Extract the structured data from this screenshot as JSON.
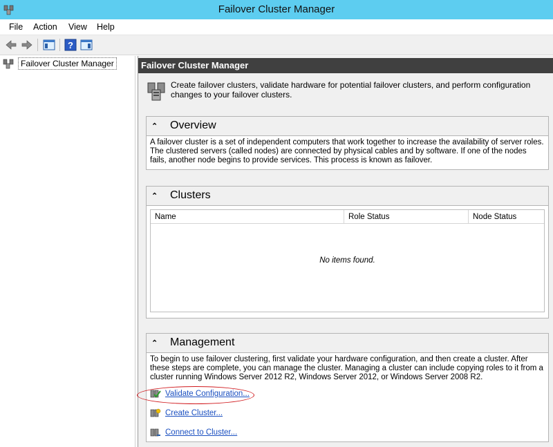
{
  "window": {
    "title": "Failover Cluster Manager",
    "app_icon": "cluster-icon"
  },
  "menu": {
    "file": "File",
    "action": "Action",
    "view": "View",
    "help": "Help"
  },
  "toolbar": {
    "icons": [
      "back-arrow-icon",
      "forward-arrow-icon",
      "show-hide-console-tree-icon",
      "help-icon",
      "show-hide-action-pane-icon"
    ]
  },
  "tree": {
    "root_label": "Failover Cluster Manager"
  },
  "main": {
    "header": "Failover Cluster Manager",
    "intro": "Create failover clusters, validate hardware for potential failover clusters, and perform configuration changes to your failover clusters."
  },
  "overview": {
    "title": "Overview",
    "text": "A failover cluster is a set of independent computers that work together to increase the availability of server roles. The clustered servers (called nodes) are connected by physical cables and by software. If one of the nodes fails, another node begins to provide services. This process is known as failover."
  },
  "clusters": {
    "title": "Clusters",
    "columns": [
      "Name",
      "Role Status",
      "Node Status"
    ],
    "empty": "No items found."
  },
  "management": {
    "title": "Management",
    "text": "To begin to use failover clustering, first validate your hardware configuration, and then create a cluster.  After these steps are complete, you can manage the cluster. Managing a cluster can include copying roles to it from a cluster running Windows Server 2012 R2, Windows Server 2012, or Windows Server 2008 R2.",
    "links": [
      "Validate Configuration...",
      "Create Cluster...",
      "Connect to Cluster..."
    ]
  },
  "colors": {
    "titlebar": "#5dcdf0",
    "header": "#404040",
    "link": "#1a4fc0",
    "highlight": "#d0181c"
  }
}
